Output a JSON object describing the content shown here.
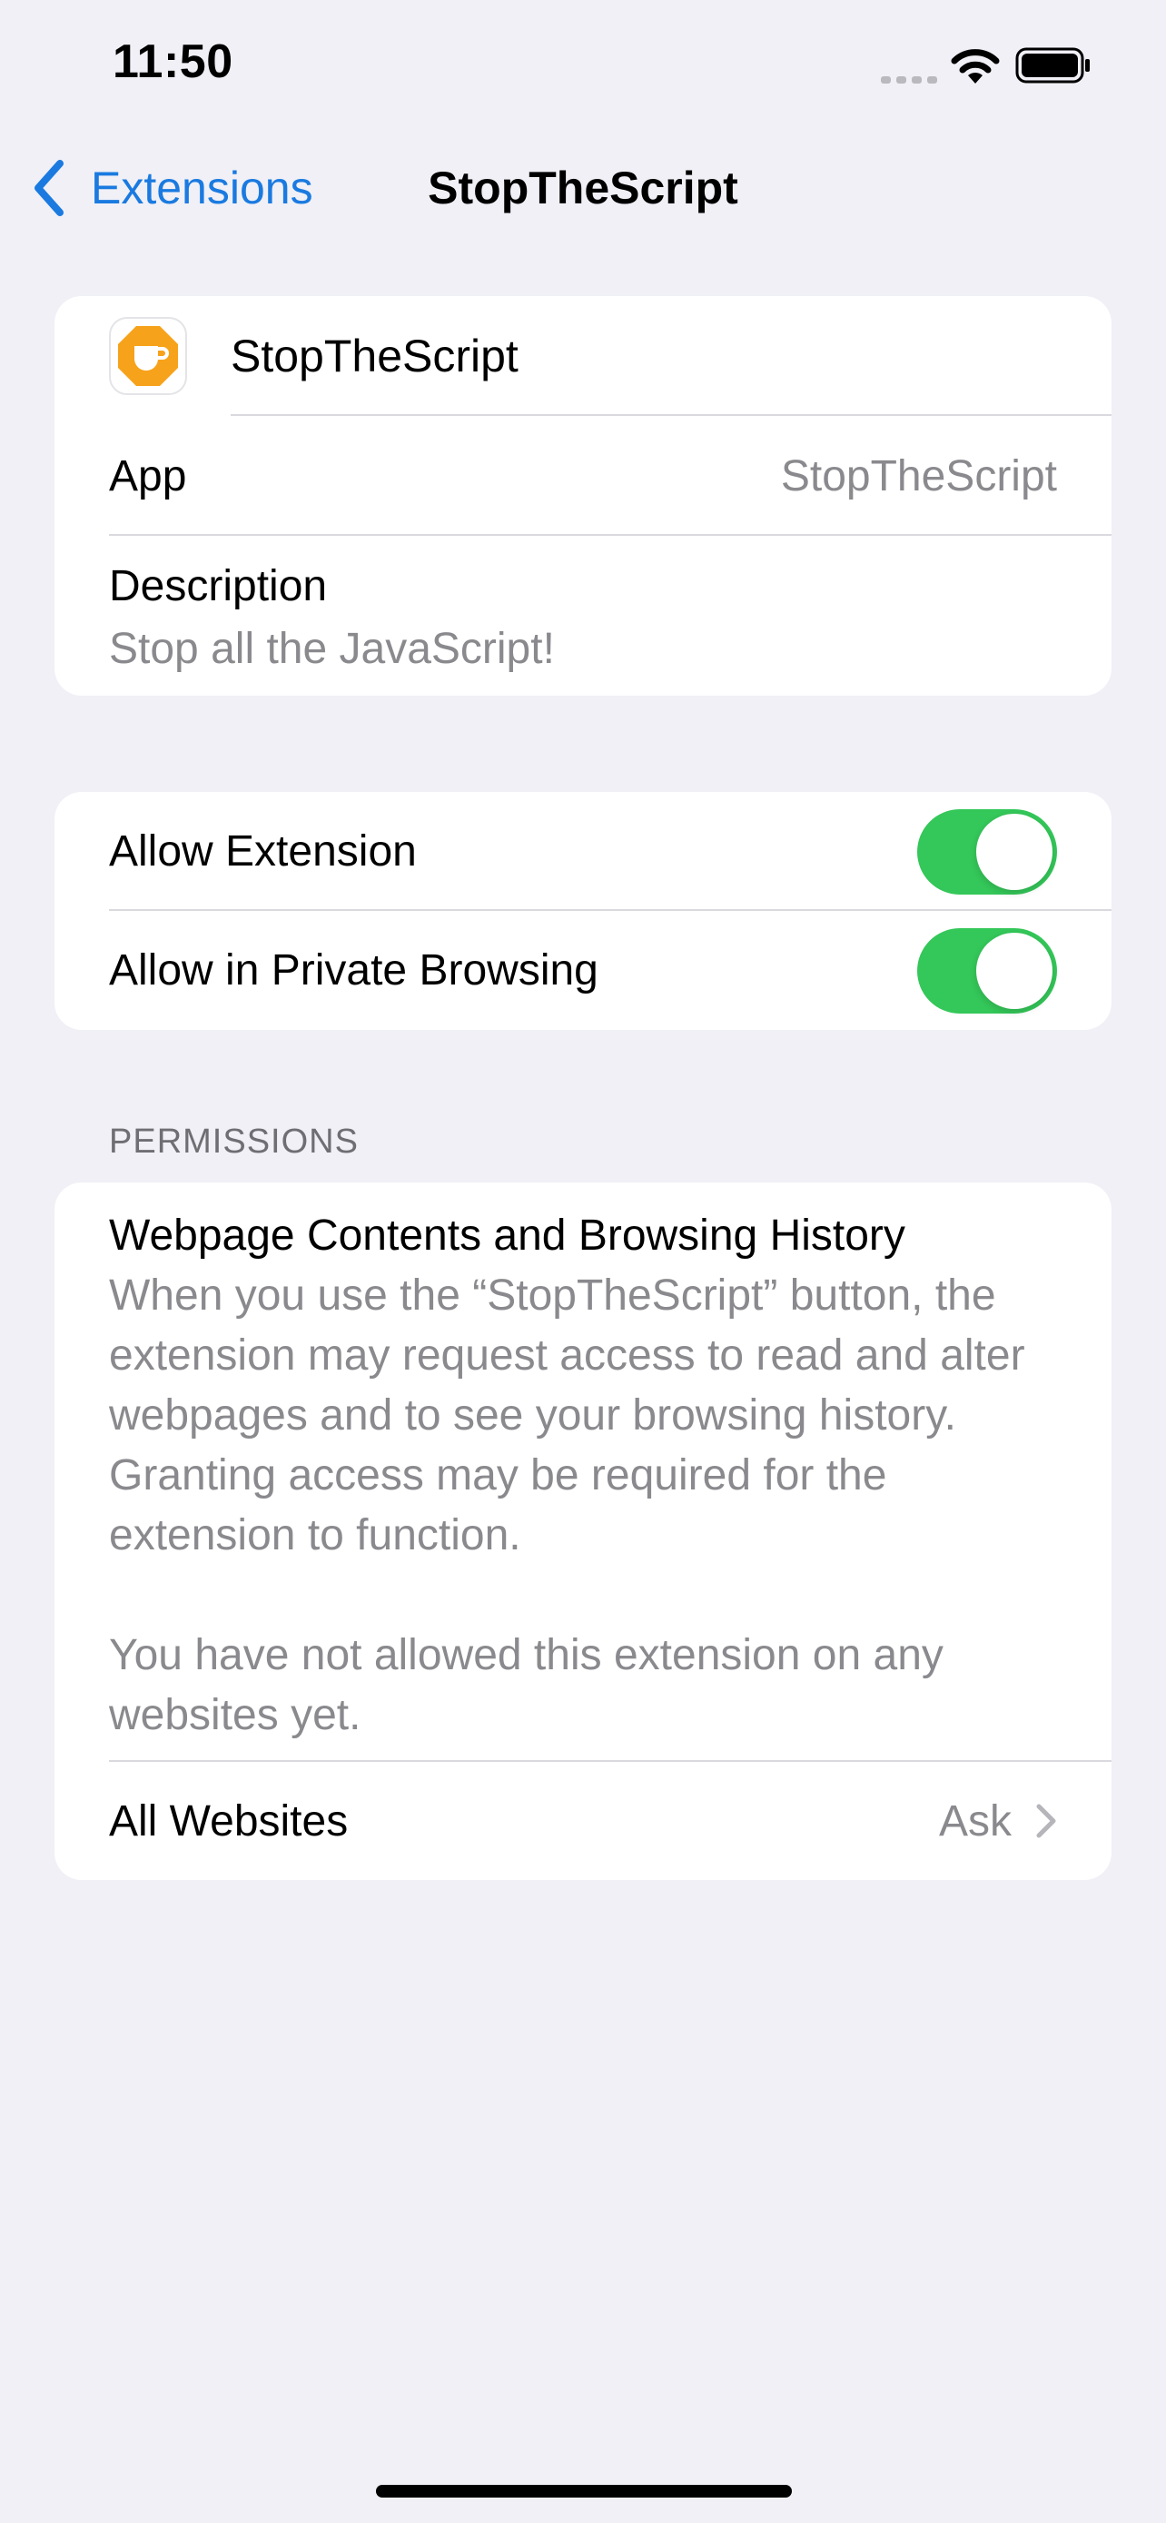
{
  "status_bar": {
    "time": "11:50"
  },
  "nav": {
    "back_label": "Extensions",
    "title": "StopTheScript"
  },
  "info": {
    "app_name": "StopTheScript",
    "app_row_label": "App",
    "app_row_value": "StopTheScript",
    "description_label": "Description",
    "description_value": "Stop all the JavaScript!"
  },
  "toggles": [
    {
      "label": "Allow Extension",
      "on": true
    },
    {
      "label": "Allow in Private Browsing",
      "on": true
    }
  ],
  "permissions": {
    "header": "PERMISSIONS",
    "title": "Webpage Contents and Browsing History",
    "description": "When you use the “StopTheScript” button, the extension may request access to read and alter webpages and to see your browsing history. Granting access may be required for the extension to function.",
    "note": "You have not allowed this extension on any websites yet.",
    "all_websites_label": "All Websites",
    "all_websites_value": "Ask"
  },
  "colors": {
    "accent": "#1a7ae0",
    "toggle_on": "#34c759",
    "background": "#f0f0f6",
    "icon_orange": "#f7a21b"
  }
}
